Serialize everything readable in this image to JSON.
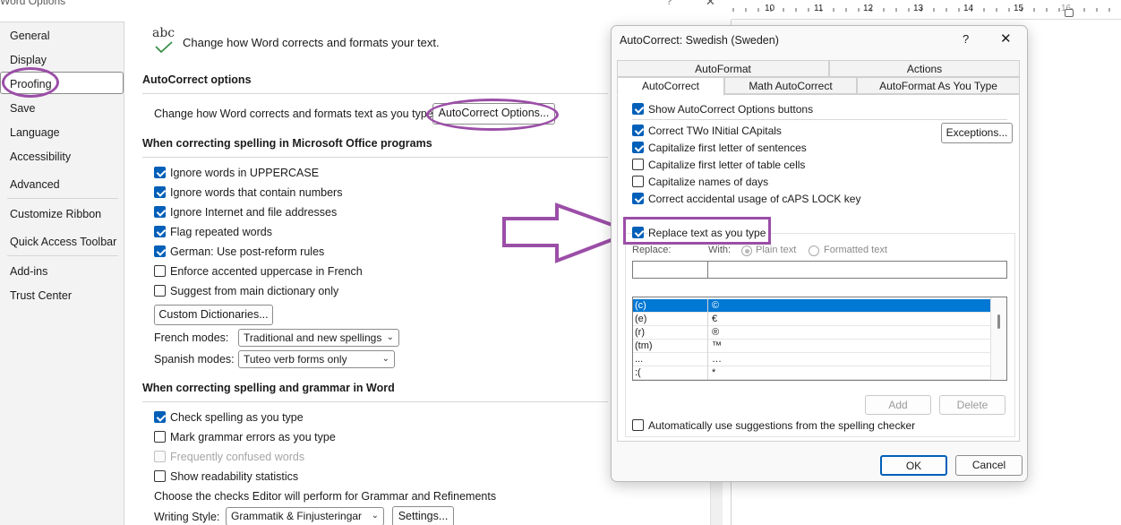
{
  "window_title": "Word Options",
  "window_controls": {
    "help": "?",
    "close": "✕"
  },
  "sidebar": {
    "items": [
      {
        "label": "General"
      },
      {
        "label": "Display"
      },
      {
        "label": "Proofing"
      },
      {
        "label": "Save"
      },
      {
        "label": "Language"
      },
      {
        "label": "Accessibility"
      },
      {
        "label": "Advanced"
      },
      {
        "label": "Customize Ribbon"
      },
      {
        "label": "Quick Access Toolbar"
      },
      {
        "label": "Add-ins"
      },
      {
        "label": "Trust Center"
      }
    ],
    "selected": "Proofing"
  },
  "header": {
    "icon_text": "abc",
    "text": "Change how Word corrects and formats your text."
  },
  "autocorrect_section": {
    "title": "AutoCorrect options",
    "description": "Change how Word corrects and formats text as you type:",
    "button": "AutoCorrect Options..."
  },
  "office_section": {
    "title": "When correcting spelling in Microsoft Office programs",
    "options": [
      {
        "label": "Ignore words in UPPERCASE",
        "checked": true
      },
      {
        "label": "Ignore words that contain numbers",
        "checked": true
      },
      {
        "label": "Ignore Internet and file addresses",
        "checked": true
      },
      {
        "label": "Flag repeated words",
        "checked": true
      },
      {
        "label": "German: Use post-reform rules",
        "checked": true
      },
      {
        "label": "Enforce accented uppercase in French",
        "checked": false
      },
      {
        "label": "Suggest from main dictionary only",
        "checked": false
      }
    ],
    "custom_dict_button": "Custom Dictionaries...",
    "french_label": "French modes:",
    "french_value": "Traditional and new spellings",
    "spanish_label": "Spanish modes:",
    "spanish_value": "Tuteo verb forms only"
  },
  "word_section": {
    "title": "When correcting spelling and grammar in Word",
    "options": [
      {
        "label": "Check spelling as you type",
        "checked": true,
        "disabled": false
      },
      {
        "label": "Mark grammar errors as you type",
        "checked": false,
        "disabled": false
      },
      {
        "label": "Frequently confused words",
        "checked": false,
        "disabled": true
      },
      {
        "label": "Show readability statistics",
        "checked": false,
        "disabled": false
      }
    ],
    "choose_text": "Choose the checks Editor will perform for Grammar and Refinements",
    "writing_style_label": "Writing Style:",
    "writing_style_value": "Grammatik & Finjusteringar",
    "settings_button": "Settings..."
  },
  "ruler": {
    "numbers": [
      "10",
      "11",
      "12",
      "13",
      "14",
      "15",
      "16"
    ]
  },
  "dialog": {
    "title": "AutoCorrect: Swedish (Sweden)",
    "help": "?",
    "close": "✕",
    "tabs_top": [
      {
        "label": "AutoFormat"
      },
      {
        "label": "Actions"
      }
    ],
    "tabs_bottom": [
      {
        "label": "AutoCorrect"
      },
      {
        "label": "Math AutoCorrect"
      },
      {
        "label": "AutoFormat As You Type"
      }
    ],
    "active_tab": "AutoCorrect",
    "show_buttons": {
      "label": "Show AutoCorrect Options buttons",
      "checked": true
    },
    "options": [
      {
        "label": "Correct TWo INitial CApitals",
        "checked": true
      },
      {
        "label": "Capitalize first letter of sentences",
        "checked": true
      },
      {
        "label": "Capitalize first letter of table cells",
        "checked": false
      },
      {
        "label": "Capitalize names of days",
        "checked": false
      },
      {
        "label": "Correct accidental usage of cAPS LOCK key",
        "checked": true
      }
    ],
    "exceptions_button": "Exceptions...",
    "replace_text": {
      "label": "Replace text as you type",
      "checked": true
    },
    "replace_label": "Replace:",
    "with_label": "With:",
    "plain_text": "Plain text",
    "formatted_text": "Formatted text",
    "replace_value": "",
    "with_value": "",
    "entries": [
      {
        "replace": "(c)",
        "with": "©"
      },
      {
        "replace": "(e)",
        "with": "€"
      },
      {
        "replace": "(r)",
        "with": "®"
      },
      {
        "replace": "(tm)",
        "with": "™"
      },
      {
        "replace": "...",
        "with": "…"
      },
      {
        "replace": ":(",
        "with": "*"
      }
    ],
    "add_button": "Add",
    "delete_button": "Delete",
    "auto_suggest": {
      "label": "Automatically use suggestions from the spelling checker",
      "checked": false
    },
    "ok_button": "OK",
    "cancel_button": "Cancel"
  },
  "annotation_color": "#9b4ea7"
}
